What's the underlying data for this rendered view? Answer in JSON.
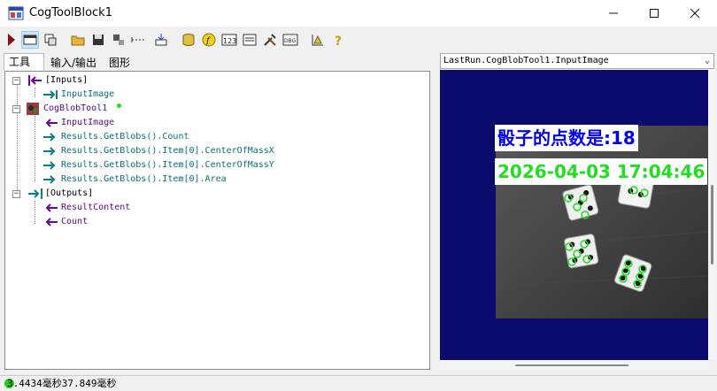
{
  "window": {
    "title": "CogToolBlock1",
    "minimize_icon": "minimize-icon",
    "maximize_icon": "maximize-icon",
    "close_icon": "close-icon"
  },
  "toolbar": {
    "icons": [
      "run-icon",
      "show-window-icon",
      "reset-icon",
      "open-folder-icon",
      "save-icon",
      "settings-icon",
      "dotted-link-icon",
      "import-icon",
      "database-icon",
      "function-icon",
      "numeric-icon",
      "form-icon",
      "tools-icon",
      "debug-icon",
      "chart-ruler-icon",
      "help-icon"
    ]
  },
  "tabs": [
    {
      "label": "工具"
    },
    {
      "label": "输入/输出"
    },
    {
      "label": "图形"
    }
  ],
  "tree": {
    "inputs_label": "[Inputs]",
    "input_image": "InputImage",
    "tool_name": "CogBlobTool1",
    "tool_input_image": "InputImage",
    "result_count": "Results.GetBlobs().Count",
    "result_cmx": "Results.GetBlobs().Item[0].CenterOfMassX",
    "result_cmy": "Results.GetBlobs().Item[0].CenterOfMassY",
    "result_area": "Results.GetBlobs().Item[0].Area",
    "outputs_label": "[Outputs]",
    "output_result_content": "ResultContent",
    "output_count": "Count"
  },
  "display": {
    "selector": "LastRun.CogBlobTool1.InputImage",
    "overlay_text": "骰子的点数是:18",
    "overlay_datetime": "2026-04-03 17:04:46",
    "colors": {
      "overlay_text": "#0000ee",
      "overlay_datetime": "#22dd22",
      "background": "#0b0b6e",
      "blob_marker": "#22dd22"
    }
  },
  "status": {
    "text": "3.4434毫秒37.849毫秒",
    "indicator_color": "#22cc22"
  }
}
